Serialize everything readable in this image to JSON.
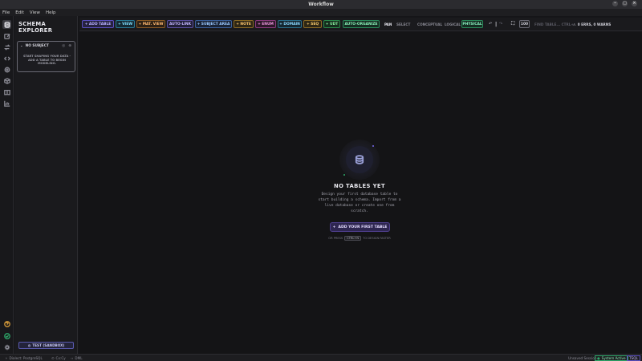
{
  "window": {
    "title": "Workflow",
    "controls": [
      "–",
      "□",
      "×"
    ]
  },
  "menu": [
    "File",
    "Edit",
    "View",
    "Help"
  ],
  "rail_icons": [
    "database-icon",
    "edit-icon",
    "swap-icon",
    "code-icon",
    "settings-icon",
    "box-icon",
    "book-icon",
    "chart-icon",
    "help-icon",
    "shield-icon",
    "gear-icon"
  ],
  "explorer": {
    "title_line1": "SCHEMA",
    "title_line2": "EXPLORER",
    "subject": {
      "label": "NO SUBJECT",
      "message": "START SHAPING YOUR DATA - ADD A TABLE TO BEGIN MODELING."
    },
    "env_button": "TEST (SANDBOX)"
  },
  "toolbar": {
    "add_table": "+ ADD TABLE",
    "view": "+ VIEW",
    "mat_view": "+ MAT. VIEW",
    "auto_link": "AUTO-LINK",
    "subject_area": "+ SUBJECT AREA",
    "note": "+ NOTE",
    "enum": "+ ENUM",
    "domain": "+ DOMAIN",
    "seq": "+ SEQ",
    "udt": "+ UDT",
    "auto_organize": "AUTO-ORGANIZE",
    "pan": "PAN",
    "select": "SELECT",
    "conceptual": "CONCEPTUAL",
    "logical": "LOGICAL",
    "physical": "PHYSICAL",
    "zoom_label": "100",
    "find_placeholder": "FIND TABLE... CTRL+",
    "errors": "0 ERRS, 0 WARNS"
  },
  "empty_state": {
    "title": "NO TABLES YET",
    "description": "Design your first database table to start building a schema. Import from a live database or create one from scratch.",
    "cta": "ADD YOUR FIRST TABLE",
    "hint_prefix": "OR PRESS",
    "hint_key": "CTRL+N",
    "hint_suffix": "TO DESIGN FASTER"
  },
  "status": {
    "left1": "Dialect: PostgreSQL",
    "left2": "Cx:Cy",
    "left3": "DML",
    "right1": "Unsaved Session",
    "right2": "System Active",
    "right3": "TSQL"
  },
  "colors": {
    "accent_purple": "#7b6cf0",
    "accent_green": "#2ea86a",
    "accent_orange": "#d49a3a"
  }
}
